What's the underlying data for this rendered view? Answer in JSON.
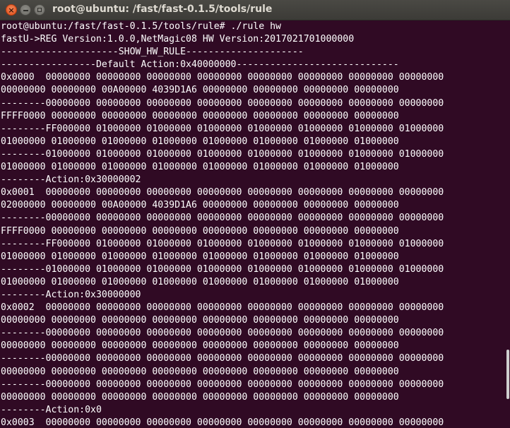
{
  "window": {
    "title": "root@ubuntu: /fast/fast-0.1.5/tools/rule",
    "close_glyph": "×",
    "buttons": [
      "close",
      "minimize",
      "maximize"
    ]
  },
  "terminal": {
    "background": "#300a24",
    "foreground": "#ffffff",
    "lines": [
      "root@ubuntu:/fast/fast-0.1.5/tools/rule# ./rule hw",
      "fastU->REG Version:1.0.0,NetMagic08 HW Version:2017021701000000",
      "---------------------SHOW_HW_RULE---------------------",
      "-----------------Default Action:0x40000000-----------------------------",
      "0x0000  00000000 00000000 00000000 00000000 00000000 00000000 00000000 00000000",
      "00000000 00000000 00A00000 4039D1A6 00000000 00000000 00000000 00000000",
      "--------00000000 00000000 00000000 00000000 00000000 00000000 00000000 00000000",
      "FFFF0000 00000000 00000000 00000000 00000000 00000000 00000000 00000000",
      "--------FF000000 01000000 01000000 01000000 01000000 01000000 01000000 01000000",
      "01000000 01000000 01000000 01000000 01000000 01000000 01000000 01000000",
      "--------01000000 01000000 01000000 01000000 01000000 01000000 01000000 01000000",
      "01000000 01000000 01000000 01000000 01000000 01000000 01000000 01000000",
      "--------Action:0x30000002",
      "0x0001  00000000 00000000 00000000 00000000 00000000 00000000 00000000 00000000",
      "02000000 00000000 00A00000 4039D1A6 00000000 00000000 00000000 00000000",
      "--------00000000 00000000 00000000 00000000 00000000 00000000 00000000 00000000",
      "FFFF0000 00000000 00000000 00000000 00000000 00000000 00000000 00000000",
      "--------FF000000 01000000 01000000 01000000 01000000 01000000 01000000 01000000",
      "01000000 01000000 01000000 01000000 01000000 01000000 01000000 01000000",
      "--------01000000 01000000 01000000 01000000 01000000 01000000 01000000 01000000",
      "01000000 01000000 01000000 01000000 01000000 01000000 01000000 01000000",
      "--------Action:0x30000000",
      "0x0002  00000000 00000000 00000000 00000000 00000000 00000000 00000000 00000000",
      "00000000 00000000 00000000 00000000 00000000 00000000 00000000 00000000",
      "--------00000000 00000000 00000000 00000000 00000000 00000000 00000000 00000000",
      "00000000 00000000 00000000 00000000 00000000 00000000 00000000 00000000",
      "--------00000000 00000000 00000000 00000000 00000000 00000000 00000000 00000000",
      "00000000 00000000 00000000 00000000 00000000 00000000 00000000 00000000",
      "--------00000000 00000000 00000000 00000000 00000000 00000000 00000000 00000000",
      "00000000 00000000 00000000 00000000 00000000 00000000 00000000 00000000",
      "--------Action:0x0",
      "0x0003  00000000 00000000 00000000 00000000 00000000 00000000 00000000 00000000"
    ]
  }
}
